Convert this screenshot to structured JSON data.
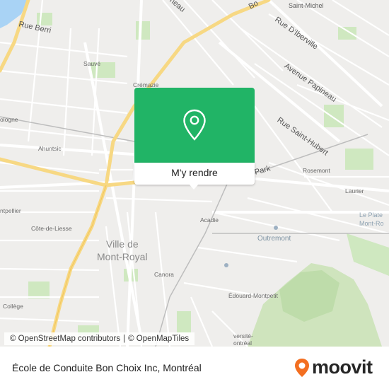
{
  "map": {
    "streets": {
      "rue_berri": "Rue Berri",
      "henri_bourassa": "Bo",
      "laurier_top": "neau",
      "saint_michel": "Saint-Michel",
      "rue_diberville": "Rue D'Iberville",
      "avenue_papineau": "Avenue Papineau",
      "rue_saint_hubert": "Rue Saint-Hubert",
      "park": "Park"
    },
    "stations": {
      "sauve": "Sauvé",
      "cremazie": "Crémazie",
      "ahuntsic": "Ahuntsic",
      "bologne": "ologne",
      "montpellier": "ntpellier",
      "cote_de_liesse": "Côte-de-Liesse",
      "rosemont": "Rosemont",
      "laurier": "Laurier",
      "acadie": "Acadie",
      "canora": "Canora",
      "edouard_montpetit": "Édouard-Montpetit",
      "college": "Collège",
      "universite_1": "versité-",
      "universite_2": "ontréal"
    },
    "neighbourhoods": {
      "mont_royal_1": "Ville de",
      "mont_royal_2": "Mont-Royal",
      "outremont": "Outremont",
      "plateau_1": "Le Plate",
      "plateau_2": "Mont-Ro"
    }
  },
  "popup": {
    "cta_label": "M'y rendre",
    "pin_icon": "location-pin-icon",
    "color": "#21b466"
  },
  "attribution": {
    "osm_contrib": "© OpenStreetMap contributors",
    "sep": "|",
    "omt": "© OpenMapTiles"
  },
  "footer": {
    "place_name": "École de Conduite Bon Choix Inc, Montréal",
    "brand": "moovit",
    "brand_color": "#f36f21"
  }
}
